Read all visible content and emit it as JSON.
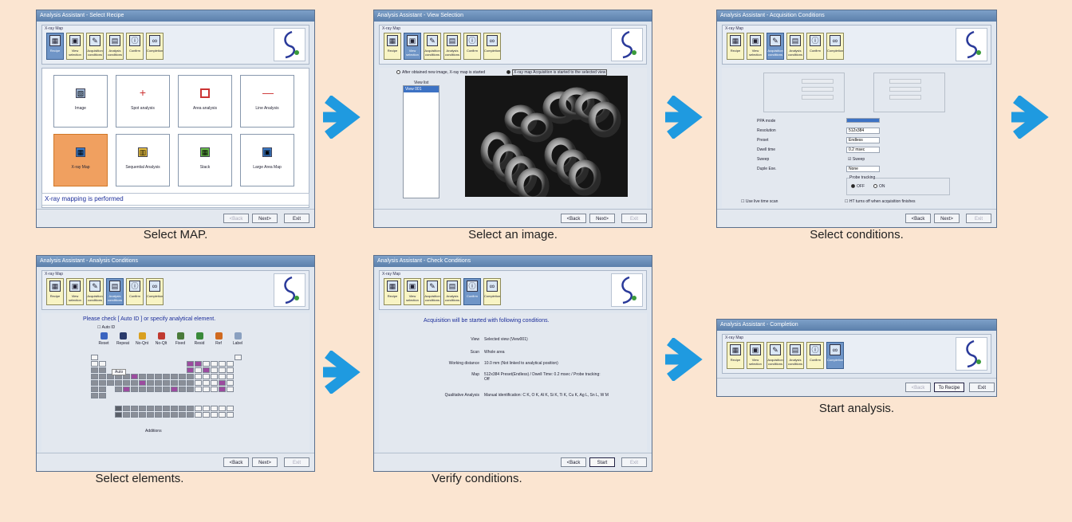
{
  "common": {
    "toolbar_label": "X-ray Map",
    "toolbar_buttons": [
      {
        "label": "Recipe",
        "icon": "recipe-icon"
      },
      {
        "label": "View selection",
        "icon": "view-selection-icon"
      },
      {
        "label": "Acquisition conditions",
        "icon": "acquisition-conditions-icon"
      },
      {
        "label": "Analysis conditions",
        "icon": "analysis-conditions-icon"
      },
      {
        "label": "Confirm",
        "icon": "confirm-icon"
      },
      {
        "label": "Completion",
        "icon": "completion-icon"
      }
    ],
    "nav": {
      "back": "<Back",
      "next": "Next>",
      "exit": "Exit"
    },
    "arrow_color": "#1f9ae0"
  },
  "screens": {
    "select_recipe": {
      "title": "Analysis Assistant - Select Recipe",
      "caption": "Select MAP.",
      "tiles": [
        "Image",
        "Spot analysis",
        "Area analysis",
        "Line Analysis",
        "X-ray Map",
        "Sequential Analysis",
        "Stack",
        "Large Area Map"
      ],
      "selected_tile": "X-ray Map",
      "message": "X-ray mapping is performed"
    },
    "view_selection": {
      "title": "Analysis Assistant - View Selection",
      "caption": "Select an image.",
      "radio_1": "After obtained new image, X-ray map is started",
      "radio_2": "X-ray map Acquisition is started to the selected view",
      "view_list_header": "View list",
      "view_list_item": "View 001"
    },
    "acquisition_conditions": {
      "title": "Analysis Assistant - Acquisition Conditions",
      "caption": "Select conditions.",
      "labels": [
        "PPA mode",
        "Resolution",
        "Preset",
        "Dwell time",
        "Sweep",
        "Duple Exe."
      ],
      "values": [
        "512x384",
        "Endless",
        "0.2 msec",
        "Sweep",
        "None"
      ],
      "probe_tracking_label": "Probe tracking",
      "probe_off": "OFF",
      "probe_on": "ON",
      "checkbox_1": "Use live time scan",
      "checkbox_2": "HT turns off when acquisition finishes"
    },
    "analysis_conditions": {
      "title": "Analysis Assistant - Analysis Conditions",
      "caption": "Select elements.",
      "prompt": "Please check [ Auto ID ] or specify analytical element.",
      "auto_id": "Auto ID",
      "element_buttons": [
        "Reset",
        "Repeat",
        "No-Qnt",
        "No-Qlt",
        "Fixed",
        "Resid",
        "Ref",
        "Label"
      ],
      "spectrum_label": "Auto",
      "additions_label": "Additions"
    },
    "check_conditions": {
      "title": "Analysis Assistant - Check Conditions",
      "caption": "Verify conditions.",
      "heading": "Acquisition will be started with following conditions.",
      "rows": [
        {
          "key": "View",
          "value": "Selected view (View001)"
        },
        {
          "key": "Scan",
          "value": "Whole area"
        },
        {
          "key": "Working distance",
          "value": "10.0 mm (Not linked to analytical position)"
        },
        {
          "key": "Map",
          "value": "512x384 Preset(Endless) / Dwell Time: 0.2 msec / Probe tracking: Off"
        },
        {
          "key": "Qualitative Analysis",
          "value": "Manual identification: C K, O K, Al K, Si K, Ti K, Cu K, Ag L, Sn L, W M"
        }
      ],
      "start_label": "Start"
    },
    "completion": {
      "title": "Analysis Assistant - Completion",
      "caption": "Start analysis.",
      "to_recipe": "To Recipe",
      "exit": "Exit",
      "back": "<Back"
    }
  }
}
